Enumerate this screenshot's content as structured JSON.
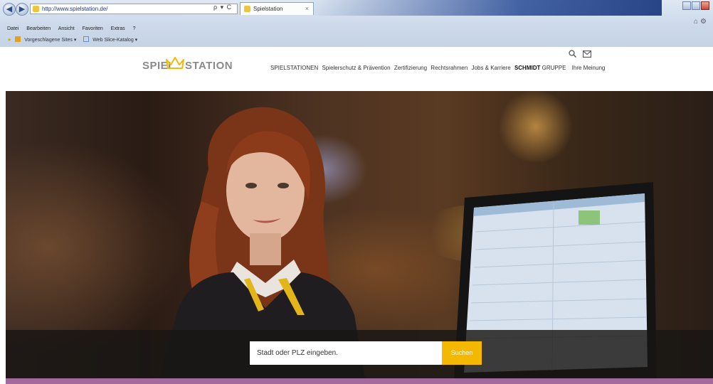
{
  "browser": {
    "address": "http://www.spielstation.de/",
    "address_tools": "ρ ▾ C",
    "tab_title": "Spielstation",
    "tab_close": "×",
    "menu": [
      "Datei",
      "Bearbeiten",
      "Ansicht",
      "Favoriten",
      "Extras",
      "?"
    ],
    "favorites": [
      "Vorgeschlagene Sites ▾",
      "Web Slice-Katalog ▾"
    ],
    "icons": {
      "back": "back-arrow-icon",
      "forward": "forward-arrow-icon",
      "home": "home-icon",
      "settings": "gear-icon"
    }
  },
  "site": {
    "logo": {
      "part1": "SPIEL",
      "part2": "STATION",
      "crown_color": "#f5b800"
    },
    "nav": [
      "SPIELSTATIONEN",
      "Spielerschutz & Prävention",
      "Zertifizierung",
      "Rechtsrahmen",
      "Jobs & Karriere"
    ],
    "nav_group": {
      "bold": "SCHMIDT",
      "rest": "GRUPPE"
    },
    "nav_last": "Ihre Meinung",
    "header_icons": [
      "search-icon",
      "mail-icon"
    ]
  },
  "hero": {
    "search_placeholder": "Stadt oder PLZ eingeben.",
    "search_button": "Suchen",
    "accent_color": "#f5b800",
    "band_color": "#a36a9c"
  }
}
